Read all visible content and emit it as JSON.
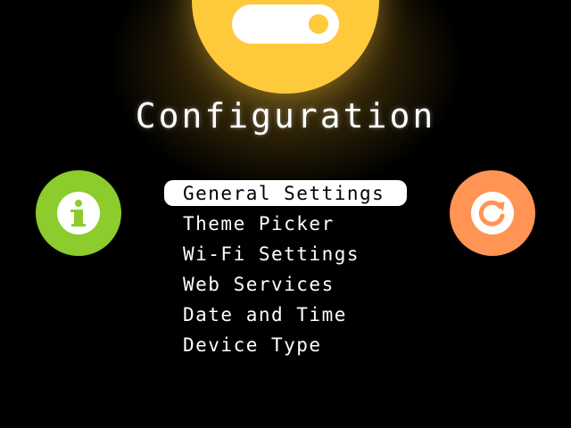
{
  "screen": {
    "title": "Configuration",
    "top_badge_icon": "toggle-switch-icon"
  },
  "menu": {
    "selected_index": 0,
    "items": [
      {
        "label": "General Settings"
      },
      {
        "label": "Theme Picker"
      },
      {
        "label": "Wi-Fi Settings"
      },
      {
        "label": "Web Services"
      },
      {
        "label": "Date and Time"
      },
      {
        "label": "Device Type"
      }
    ]
  },
  "side_buttons": {
    "left": {
      "icon": "info-icon",
      "color": "#8ccc2c"
    },
    "right": {
      "icon": "refresh-icon",
      "color": "#ff9454"
    }
  },
  "colors": {
    "background": "#000000",
    "accent_yellow": "#ffc93c",
    "text": "#ffffff"
  }
}
